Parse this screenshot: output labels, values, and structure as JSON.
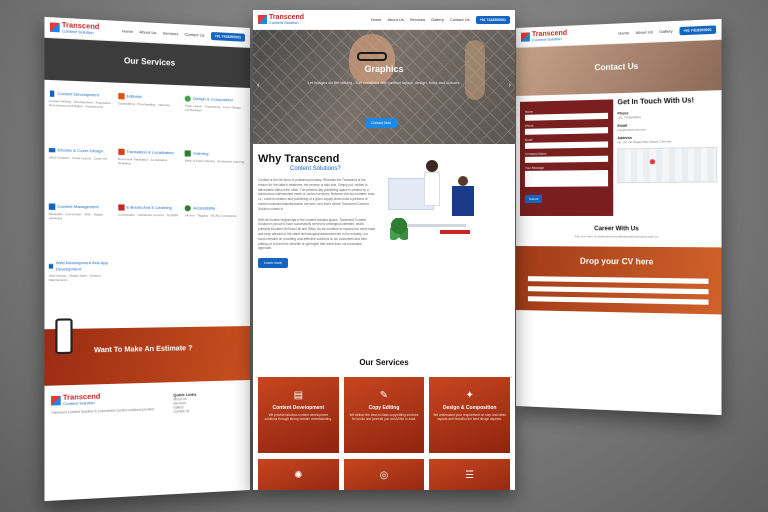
{
  "brand": {
    "name": "Transcend",
    "tagline": "Content Solution"
  },
  "nav": {
    "links": [
      "Home",
      "About Us",
      "Services",
      "Gallery",
      "Contact Us"
    ],
    "phone_button": "+91 7418200001"
  },
  "hero": {
    "title": "Graphics",
    "subtitle": "Let images do the talking - Get creatives with perfect layout, design, fonts and colours.",
    "button": "Contact Now",
    "prev": "‹",
    "next": "›"
  },
  "why": {
    "title": "Why Transcend",
    "subtitle": "Content Solutions?",
    "para1": "Content is the life-force of publishing industry. Whereas the Transcend is the reason for the latter's existence; the reverse is also true. Simply put, neither is fathomable without the other. The present-day publishing space is welded by a harmonious intermeshed mesh of content services. Between the two extreme ends i.e., content creation and publishing of a given supply chain exist a plethora of content solutions/transformation services, and that's where Transcend Content Solution comes in.",
    "para2": "With its humble beginnings in the content solution space, Transcend Content Solution is proud to have successfully served to prestigious clientele, which primarily includes McGraw-Hill and Wiley. As we continue to expand our client base and keep abreast of the latest technological advancements in the industry, our focus remains on providing cost-effective solutions to our customers and thus putting on to them the benefits of synergies that result from our innovative approach.",
    "button": "Learn more"
  },
  "services": {
    "title": "Our Services",
    "cards": [
      {
        "icon": "document-icon",
        "glyph": "▤",
        "title": "Content Development",
        "text": "We provide fabulous content development solutions through strong domain understanding."
      },
      {
        "icon": "edit-icon",
        "glyph": "✎",
        "title": "Copy Editing",
        "text": "We deliver the best-in-class copyediting services for books and journals you would like to avail."
      },
      {
        "icon": "design-icon",
        "glyph": "✦",
        "title": "Design & Composition",
        "text": "We understand your requirement on step and clean layouts and beautiful the best design aspects."
      }
    ],
    "cards_row2": [
      {
        "icon": "maple-icon",
        "glyph": "✺"
      },
      {
        "icon": "target-icon",
        "glyph": "◎"
      },
      {
        "icon": "list-icon",
        "glyph": "☰"
      }
    ]
  },
  "left_page": {
    "banner": "Our Services",
    "items": [
      {
        "title": "Content Development",
        "text": "Content Writing · Development · Acquisition · Permissions and Rights · Assessment"
      },
      {
        "title": "Editorial",
        "text": "Copyediting · Proofreading · Indexing"
      },
      {
        "title": "Design & Composition",
        "text": "Page Layout · Typesetting · Cover Design · Art Redraws"
      },
      {
        "title": "Ebooks & Cover Design",
        "text": "ePub Creation · Fixed Layout · Cover Art"
      },
      {
        "title": "Translation & Localization",
        "text": "Document Translation · Localization · Subtitling"
      },
      {
        "title": "Indexing",
        "text": "Back of book Indexing · Embedded Indexing"
      },
      {
        "title": "Content Management",
        "text": "Metadata · Conversion · XML · Digital Archiving"
      },
      {
        "title": "E-Books And E-Learning",
        "text": "Courseware · Interactive Content · SCORM"
      },
      {
        "title": "Accessibility",
        "text": "Alt-text · Tagging · WCAG Compliance"
      },
      {
        "title": "Web Development And App Development",
        "text": "Web Design · Mobile Apps · Hosting · Maintenance"
      }
    ],
    "estimate": "Want To Make An Estimate ?",
    "footer_about": "Transcend Content Solution is a prominent content solutions provider.",
    "footer_links_title": "Quick Links",
    "footer_links": [
      "About Us",
      "Services",
      "Gallery",
      "Contact Us"
    ]
  },
  "right_page": {
    "banner": "Contact Us",
    "form_labels": [
      "Name",
      "Phone",
      "Email",
      "Company Name",
      "Your Message"
    ],
    "form_button": "Submit",
    "get_in_touch": "Get In Touch With Us!",
    "phone_label": "Phone",
    "phone_value": "+91 7418200001",
    "email_label": "Email",
    "email_value": "info@transcend.com",
    "address_label": "Address",
    "address_value": "No. 23, Sri Nagar Main Road, Chennai",
    "career_title": "Career With Us",
    "career_text": "Join our team of experienced professionals and grow with us.",
    "cv_title": "Drop your CV here"
  },
  "colors": {
    "accent": "#1565c0",
    "brand_red": "#c62828",
    "card_start": "#c7461f",
    "card_end": "#8f2410"
  }
}
